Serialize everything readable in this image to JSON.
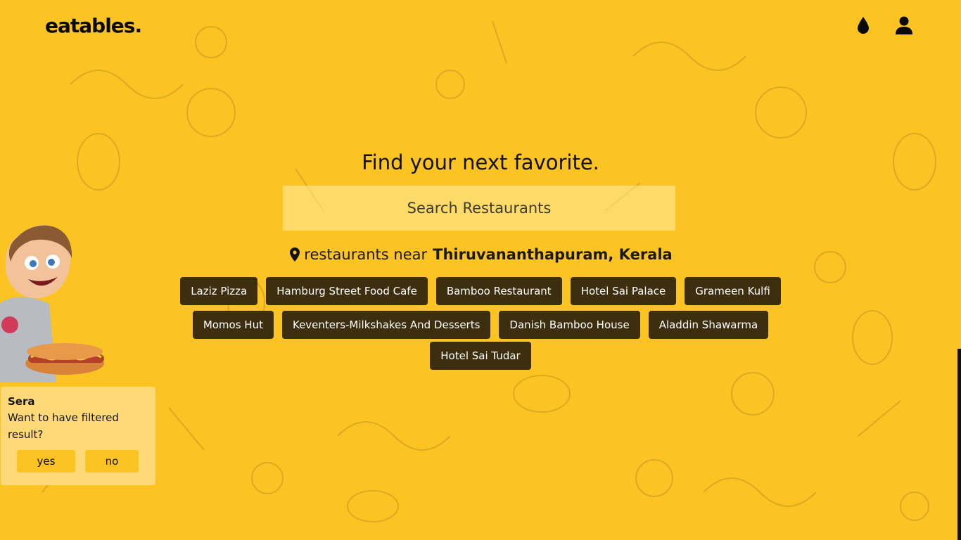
{
  "brand": {
    "logo": "eatables."
  },
  "header": {
    "icons": [
      {
        "name": "theme-drop-icon"
      },
      {
        "name": "user-icon"
      }
    ]
  },
  "hero": {
    "title": "Find your next favorite.",
    "search_placeholder": "Search Restaurants",
    "near_prefix": "restaurants near",
    "location": "Thiruvananthapuram, Kerala"
  },
  "restaurants": {
    "row1": [
      "Laziz Pizza",
      "Hamburg Street Food Cafe",
      "Bamboo Restaurant",
      "Hotel Sai Palace",
      "Grameen Kulfi"
    ],
    "row2": [
      "Momos Hut",
      "Keventers-Milkshakes And Desserts",
      "Danish Bamboo House",
      "Aladdin Shawarma"
    ],
    "row3": [
      "Hotel Sai Tudar"
    ]
  },
  "assistant": {
    "name": "Sera",
    "message": "Want to have filtered result?",
    "yes_label": "yes",
    "no_label": "no"
  },
  "colors": {
    "background": "#fcc423",
    "chip": "#3c2e0e",
    "card": "#ffd977"
  }
}
